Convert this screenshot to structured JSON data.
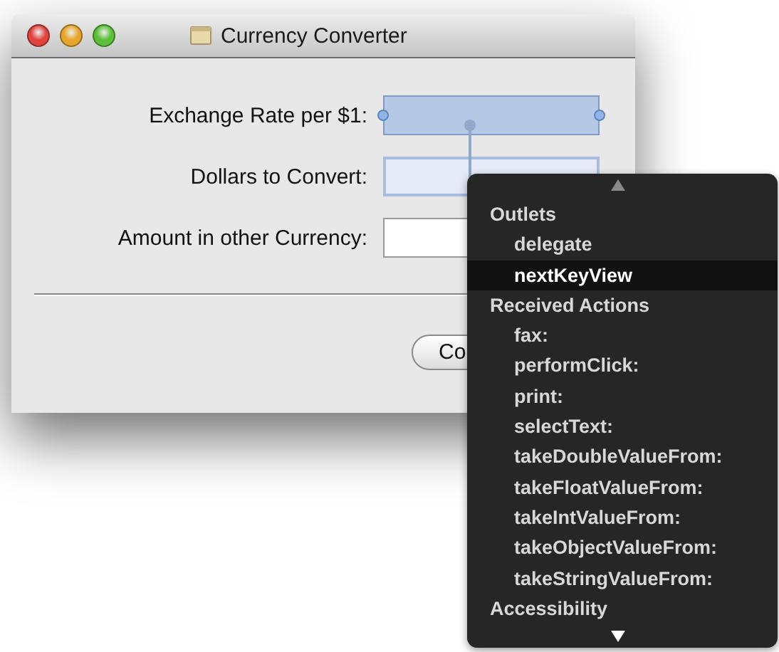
{
  "window": {
    "title": "Currency Converter"
  },
  "form": {
    "fields": [
      {
        "label": "Exchange Rate per $1:",
        "selected": true,
        "target": false
      },
      {
        "label": "Dollars to Convert:",
        "selected": false,
        "target": true
      },
      {
        "label": "Amount in other Currency:",
        "selected": false,
        "target": false
      }
    ],
    "button": "Co"
  },
  "connections_menu": {
    "sections": [
      {
        "title": "Outlets",
        "items": [
          {
            "label": "delegate",
            "selected": false
          },
          {
            "label": "nextKeyView",
            "selected": true
          }
        ]
      },
      {
        "title": "Received Actions",
        "items": [
          {
            "label": "fax:",
            "selected": false
          },
          {
            "label": "performClick:",
            "selected": false
          },
          {
            "label": "print:",
            "selected": false
          },
          {
            "label": "selectText:",
            "selected": false
          },
          {
            "label": "takeDoubleValueFrom:",
            "selected": false
          },
          {
            "label": "takeFloatValueFrom:",
            "selected": false
          },
          {
            "label": "takeIntValueFrom:",
            "selected": false
          },
          {
            "label": "takeObjectValueFrom:",
            "selected": false
          },
          {
            "label": "takeStringValueFrom:",
            "selected": false
          }
        ]
      },
      {
        "title": "Accessibility"
      }
    ]
  }
}
